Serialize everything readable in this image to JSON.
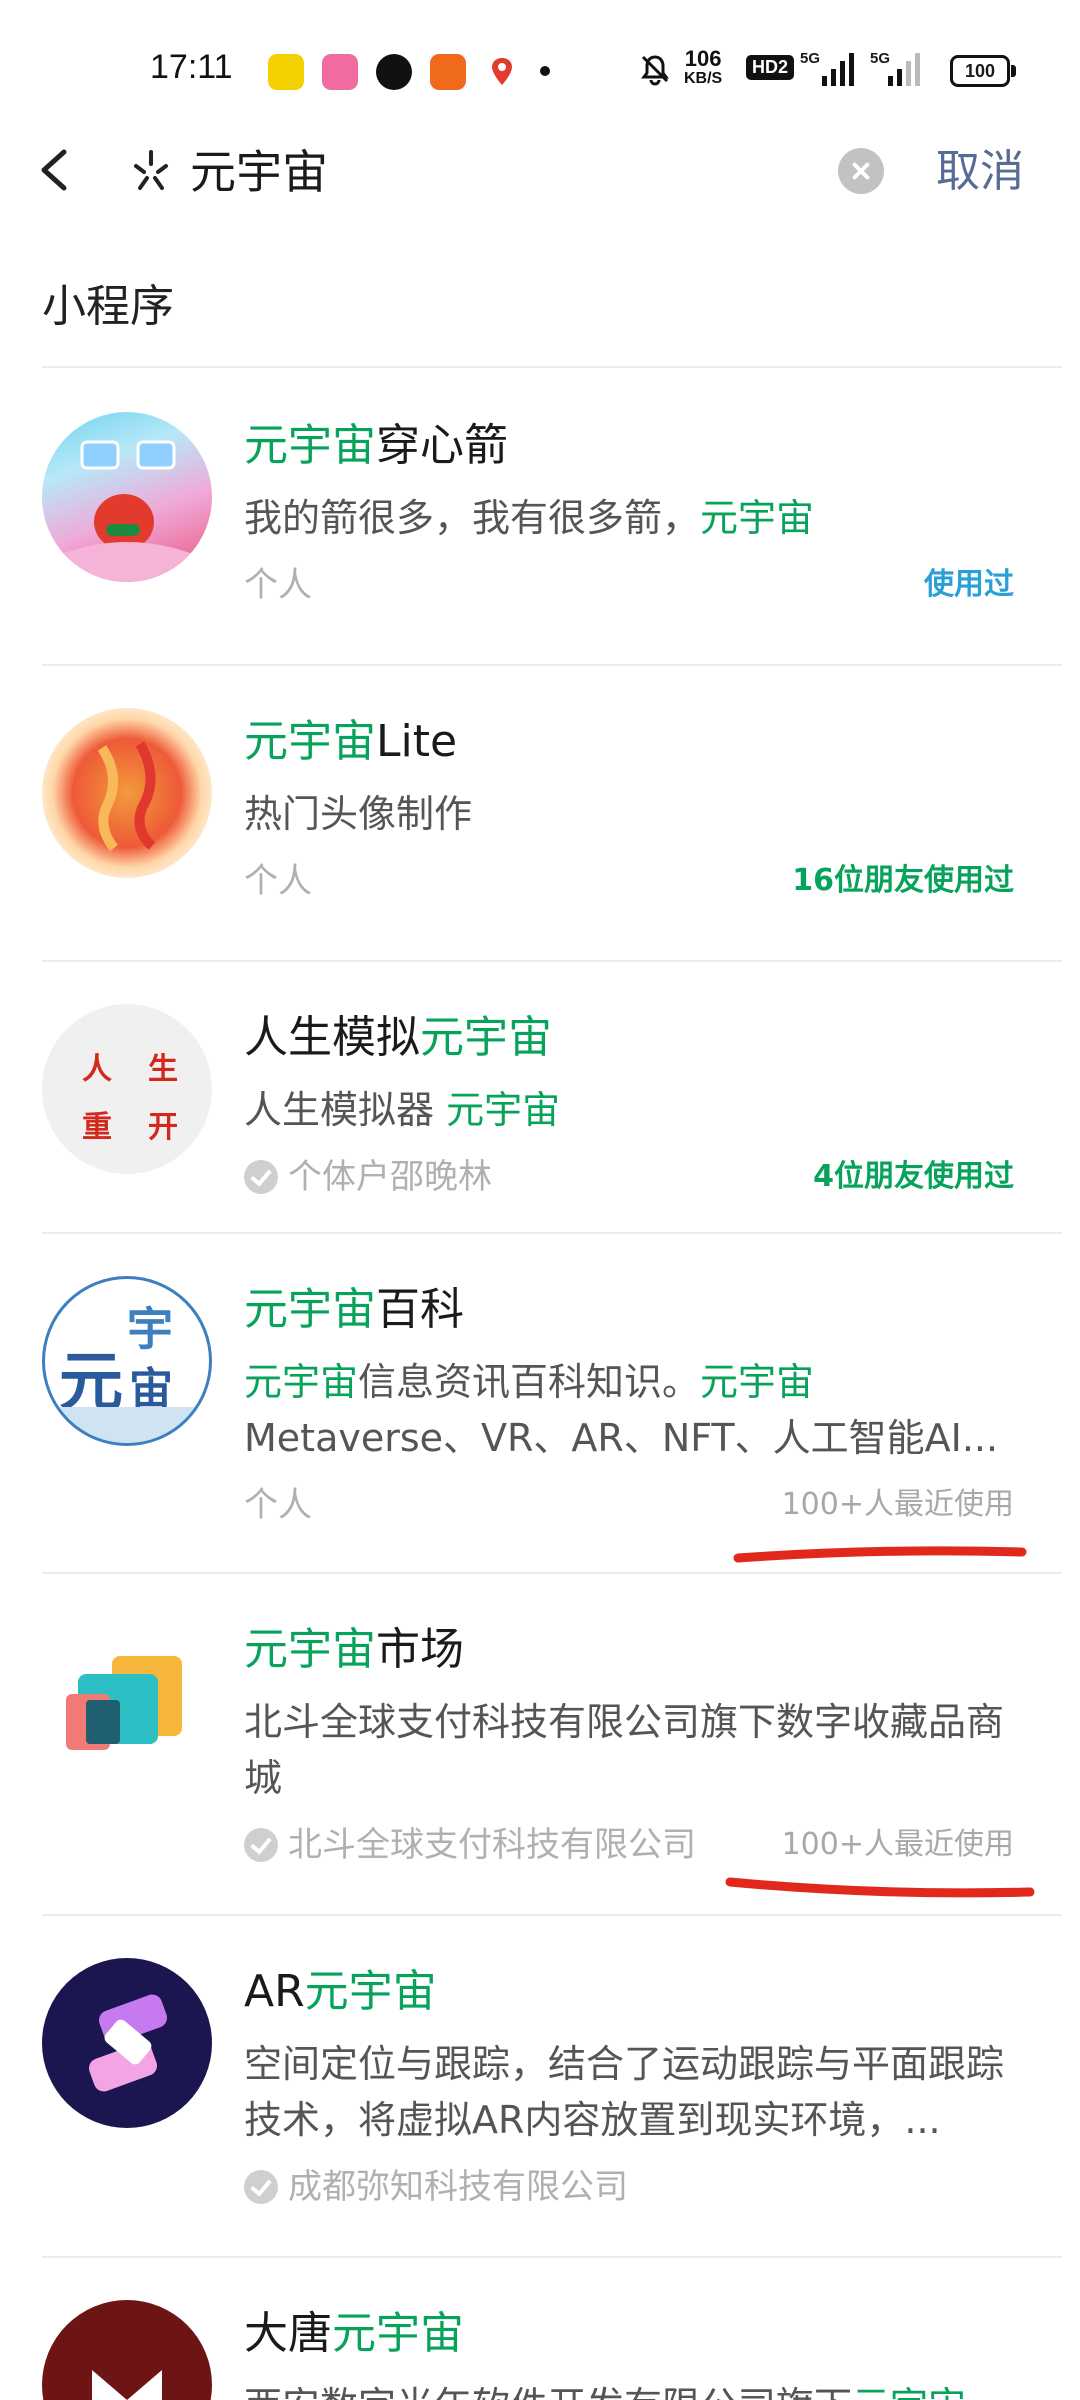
{
  "status_bar": {
    "time": "17:11",
    "net_speed_value": "106",
    "net_speed_unit": "KB/S",
    "hd_label": "HD2",
    "signal1_label": "5G",
    "signal2_label": "5G",
    "battery": "100",
    "icons": [
      "app-icon-yellow",
      "bilibili-icon",
      "bird-icon",
      "orange-app-icon",
      "map-pin-icon",
      "notification-dot",
      "bell-muted-icon"
    ]
  },
  "search": {
    "query": "元宇宙",
    "cancel_label": "取消"
  },
  "section": {
    "title": "小程序"
  },
  "results": [
    {
      "title_pre": "",
      "title_hl": "元宇宙",
      "title_post": "穿心箭",
      "desc_pre": "我的箭很多，我有很多箭，",
      "desc_hl": "元宇宙",
      "desc_post": "",
      "meta": "个人",
      "verified": false,
      "tag": "使用过",
      "tag_type": "used"
    },
    {
      "title_pre": "",
      "title_hl": "元宇宙",
      "title_post": "Lite",
      "desc_pre": "热门头像制作",
      "desc_hl": "",
      "desc_post": "",
      "meta": "个人",
      "verified": false,
      "tag": "16位朋友使用过",
      "tag_type": "friends"
    },
    {
      "title_pre": "人生模拟",
      "title_hl": "元宇宙",
      "title_post": "",
      "desc_pre": "人生模拟器 ",
      "desc_hl": "元宇宙",
      "desc_post": "",
      "meta": "个体户邵晚林",
      "verified": true,
      "tag": "4位朋友使用过",
      "tag_type": "friends",
      "avatar_text": [
        "人",
        "生",
        "重",
        "开"
      ]
    },
    {
      "title_pre": "",
      "title_hl": "元宇宙",
      "title_post": "百科",
      "desc_pre": "",
      "desc_hl": "元宇宙",
      "desc_post": "信息资讯百科知识。",
      "desc_hl2": "元宇宙",
      "desc_line2": "Metaverse、VR、AR、NFT、人工智能AI...",
      "meta": "个人",
      "verified": false,
      "tag": "100+人最近使用",
      "tag_type": "recent",
      "avatar_text": [
        "元",
        "宇",
        "宙"
      ]
    },
    {
      "title_pre": "",
      "title_hl": "元宇宙",
      "title_post": "市场",
      "desc_pre": "北斗全球支付科技有限公司旗下数字收藏品商城",
      "desc_hl": "",
      "desc_post": "",
      "meta": "北斗全球支付科技有限公司",
      "verified": true,
      "tag": "100+人最近使用",
      "tag_type": "recent"
    },
    {
      "title_pre": "AR",
      "title_hl": "元宇宙",
      "title_post": "",
      "desc_pre": "空间定位与跟踪，结合了运动跟踪与平面跟踪技术，将虚拟AR内容放置到现实环境，...",
      "desc_hl": "",
      "desc_post": "",
      "meta": "成都弥知科技有限公司",
      "verified": true,
      "tag": "",
      "tag_type": ""
    },
    {
      "title_pre": "大唐",
      "title_hl": "元宇宙",
      "title_post": "",
      "desc_pre": "西安数字光年软件开发有限公司旗下",
      "desc_hl": "元宇宙",
      "desc_post": "",
      "meta": "",
      "verified": false,
      "tag": "",
      "tag_type": ""
    }
  ],
  "colors": {
    "highlight": "#07a35a",
    "cancel": "#576b95",
    "used_tag": "#2aa0d8",
    "annotation_red": "#e0281c"
  }
}
